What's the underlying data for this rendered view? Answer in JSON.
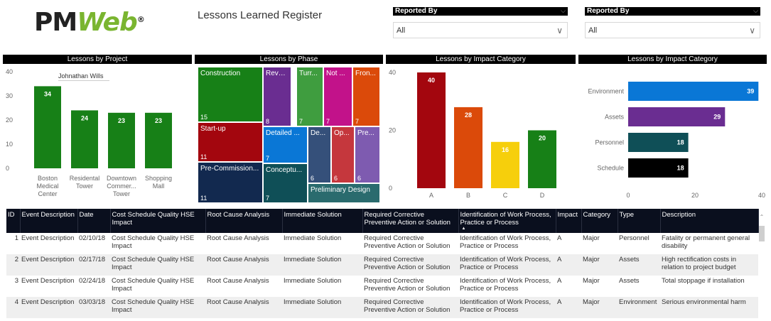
{
  "header": {
    "logo_text_a": "PM",
    "logo_text_b": "Web",
    "logo_mark": "®",
    "title": "Lessons Learned Register"
  },
  "filters": [
    {
      "label": "Reported By",
      "value": "All"
    },
    {
      "label": "Reported By",
      "value": "All"
    }
  ],
  "icons": {
    "dropdown": "chevron-down-icon",
    "scroll_up": "caret-up-icon",
    "sort": "sort-ascending-icon"
  },
  "colors": {
    "green": "#178017",
    "purple": "#6a2d91",
    "teal": "#0f4f57",
    "black": "#000000",
    "blue": "#0a77d6"
  },
  "panels": {
    "project_title": "Lessons by Project",
    "phase_title": "Lessons by Phase",
    "impact_title_1": "Lessons by Impact Category",
    "impact_title_2": "Lessons by Impact Category"
  },
  "tooltip": {
    "text": "Johnathan Wills"
  },
  "chart_data": [
    {
      "type": "bar",
      "title": "Lessons by Project",
      "categories": [
        "Boston Medical Center",
        "Residental Tower",
        "Downtown Commer... Tower",
        "Shopping Mall"
      ],
      "category_lines": [
        [
          "Boston",
          "Medical",
          "Center"
        ],
        [
          "Residental",
          "Tower"
        ],
        [
          "Downtown",
          "Commer...",
          "Tower"
        ],
        [
          "Shopping",
          "Mall"
        ]
      ],
      "values": [
        34,
        24,
        23,
        23
      ],
      "yticks": [
        0,
        10,
        20,
        30,
        40
      ],
      "ylim": [
        0,
        40
      ],
      "color": "#178017",
      "data_labels": true
    },
    {
      "type": "treemap",
      "title": "Lessons by Phase",
      "items": [
        {
          "label": "Construction",
          "value": 15,
          "color": "#178017"
        },
        {
          "label": "Revamp",
          "value": 8,
          "color": "#6a2d91"
        },
        {
          "label": "Turr...",
          "value": 7,
          "color": "#3f9d3f"
        },
        {
          "label": "Not ...",
          "value": 7,
          "color": "#c2128a"
        },
        {
          "label": "Fron...",
          "value": 7,
          "color": "#db4a0a"
        },
        {
          "label": "Start-up",
          "value": 11,
          "color": "#a3060e"
        },
        {
          "label": "Detailed ...",
          "value": 7,
          "color": "#0a77d6"
        },
        {
          "label": "De...",
          "value": 6,
          "color": "#35507a"
        },
        {
          "label": "Op...",
          "value": 6,
          "color": "#c5373d"
        },
        {
          "label": "Pre...",
          "value": 6,
          "color": "#7e5bb0"
        },
        {
          "label": "Pre-Commission...",
          "value": 11,
          "color": "#12294f"
        },
        {
          "label": "Conceptu...",
          "value": 7,
          "color": "#0f4f57"
        },
        {
          "label": "Preliminary Design",
          "value": null,
          "color": "#2a6b6e"
        }
      ]
    },
    {
      "type": "bar",
      "title": "Lessons by Impact Category",
      "categories": [
        "A",
        "B",
        "C",
        "D"
      ],
      "values": [
        40,
        28,
        16,
        20
      ],
      "colors": [
        "#a3060e",
        "#db4a0a",
        "#f6cf0c",
        "#178017"
      ],
      "yticks": [
        0,
        20,
        40
      ],
      "ylim": [
        0,
        40
      ],
      "data_labels": true
    },
    {
      "type": "bar",
      "orientation": "horizontal",
      "title": "Lessons by Impact Category",
      "categories": [
        "Environment",
        "Assets",
        "Personnel",
        "Schedule"
      ],
      "values": [
        39,
        29,
        18,
        18
      ],
      "colors": [
        "#0a77d6",
        "#6a2d91",
        "#0f4f57",
        "#000000"
      ],
      "xticks": [
        0,
        20,
        40
      ],
      "xlim": [
        0,
        40
      ],
      "data_labels": true
    }
  ],
  "table": {
    "columns": [
      "ID",
      "Event Description",
      "Date",
      "Cost Schedule Quality HSE Impact",
      "Root Cause Analysis",
      "Immediate Solution",
      "Required Corrective Preventive Action or Solution",
      "Identification of Work Process, Practice or Process",
      "Impact",
      "Category",
      "Type",
      "Description"
    ],
    "rows": [
      [
        "1",
        "Event Description",
        "02/10/18",
        "Cost Schedule Quality HSE Impact",
        "Root Cause Analysis",
        "Immediate Solution",
        "Required Corrective Preventive Action or Solution",
        "Identification of Work Process, Practice or Process",
        "A",
        "Major",
        "Personnel",
        "Fatality or permanent general disability"
      ],
      [
        "2",
        "Event Description",
        "02/17/18",
        "Cost Schedule Quality HSE Impact",
        "Root Cause Analysis",
        "Immediate Solution",
        "Required Corrective Preventive Action or Solution",
        "Identification of Work Process, Practice or Process",
        "A",
        "Major",
        "Assets",
        "High rectification costs in relation to project budget"
      ],
      [
        "3",
        "Event Description",
        "02/24/18",
        "Cost Schedule Quality HSE Impact",
        "Root Cause Analysis",
        "Immediate Solution",
        "Required Corrective Preventive Action or Solution",
        "Identification of Work Process, Practice or Process",
        "A",
        "Major",
        "Assets",
        "Total stoppage if installation"
      ],
      [
        "4",
        "Event Description",
        "03/03/18",
        "Cost Schedule Quality HSE Impact",
        "Root Cause Analysis",
        "Immediate Solution",
        "Required Corrective Preventive Action or Solution",
        "Identification of Work Process, Practice or Process",
        "A",
        "Major",
        "Environment",
        "Serious environmental harm"
      ]
    ]
  }
}
